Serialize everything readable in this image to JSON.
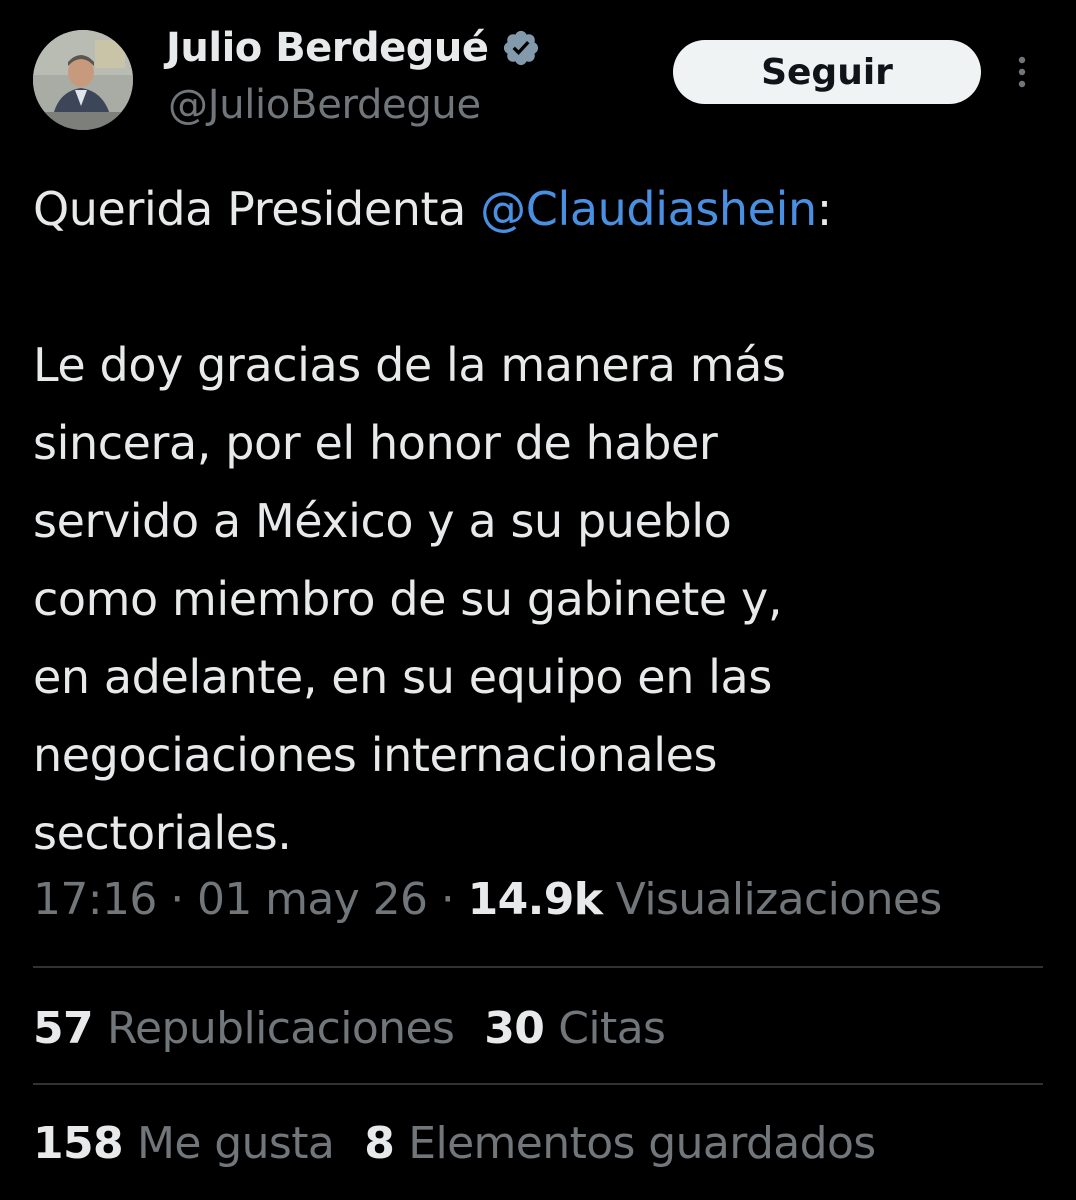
{
  "user": {
    "display_name": "Julio Berdegué",
    "handle": "@JulioBerdegue",
    "verified_icon": "verified-badge-icon",
    "avatar_icon": "profile-photo"
  },
  "actions": {
    "follow_label": "Seguir",
    "more_icon": "more-vertical-icon"
  },
  "tweet": {
    "line1_prefix": "Querida Presidenta ",
    "mention": "@Claudiashein",
    "line1_suffix": ":",
    "paragraph_lines": [
      "Le doy gracias de la manera más",
      "sincera, por el honor de haber",
      "servido a México y a su pueblo",
      "como miembro de su gabinete y,",
      "en adelante, en su equipo en las",
      "negociaciones internacionales",
      "sectoriales."
    ]
  },
  "meta": {
    "time": "17:16",
    "separator": " · ",
    "date": "01 may 26",
    "views_count": "14.9k",
    "views_label": "Visualizaciones"
  },
  "stats": {
    "reposts_count": "57",
    "reposts_label": "Republicaciones",
    "quotes_count": "30",
    "quotes_label": "Citas",
    "likes_count": "158",
    "likes_label": "Me gusta",
    "bookmarks_count": "8",
    "bookmarks_label": "Elementos guardados"
  },
  "colors": {
    "background": "#000000",
    "text": "#e7e9ea",
    "secondary_text": "#71767b",
    "mention": "#4a90e2",
    "button_bg": "#eff3f4",
    "divider": "#2f3336"
  }
}
